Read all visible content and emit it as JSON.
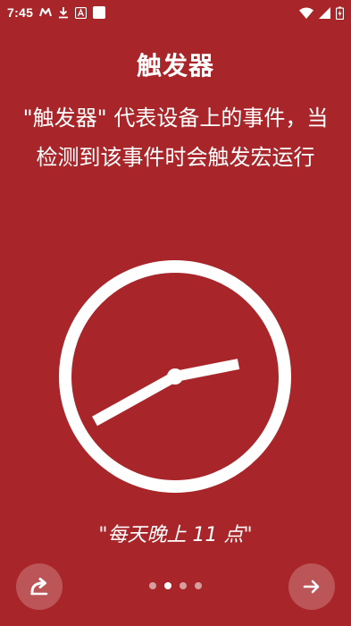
{
  "status_bar": {
    "time": "7:45",
    "icons": [
      "m-notification-icon",
      "download-icon",
      "a-notification-icon",
      "app-notification-icon",
      "wifi-icon",
      "signal-icon",
      "battery-charging-icon"
    ]
  },
  "intro": {
    "title": "触发器",
    "description": "\"触发器\" 代表设备上的事件，当检测到该事件时会触发宏运行",
    "example": "\"每天晚上 11 点\""
  },
  "illustration": {
    "icon": "clock-icon"
  },
  "navigation": {
    "skip_icon": "skip-icon",
    "next_icon": "arrow-right-icon",
    "page_count": 4,
    "active_page": 2
  },
  "colors": {
    "background": "#a8262a",
    "foreground": "#ffffff"
  }
}
